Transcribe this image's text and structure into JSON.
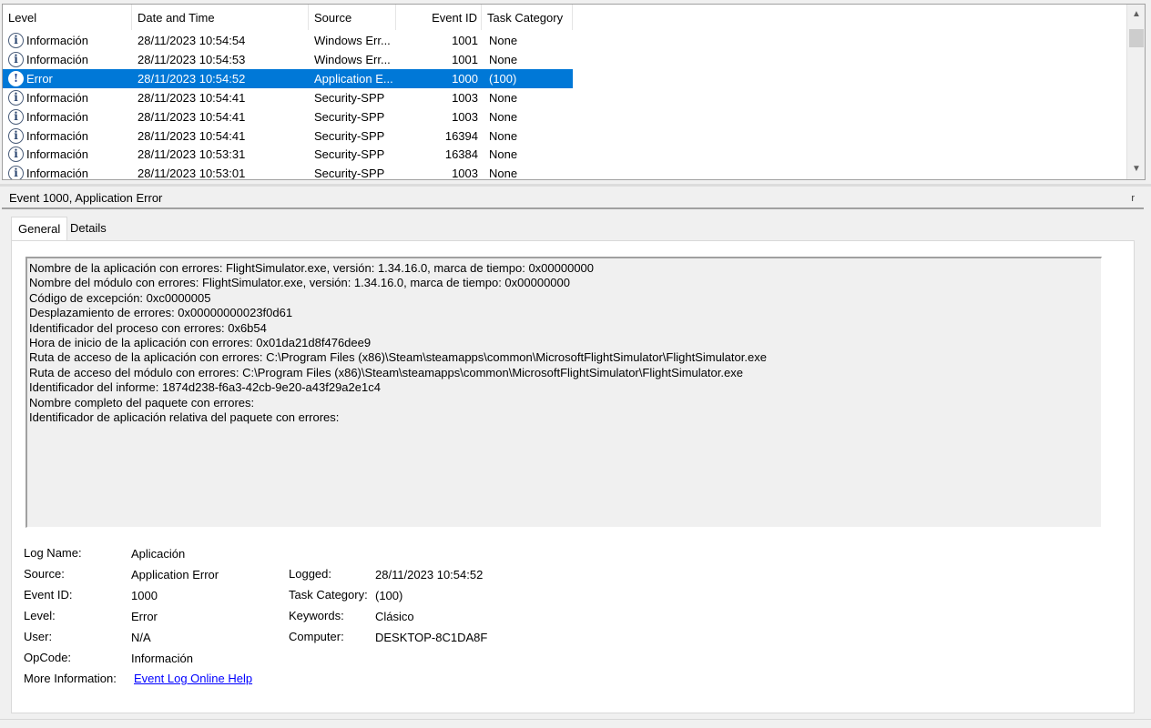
{
  "list": {
    "columns": [
      "Level",
      "Date and Time",
      "Source",
      "Event ID",
      "Task Category"
    ],
    "rows": [
      {
        "level": "Información",
        "date": "28/11/2023 10:54:54",
        "source": "Windows Err...",
        "event_id": "1001",
        "category": "None",
        "icon": "info-icon",
        "selected": false
      },
      {
        "level": "Información",
        "date": "28/11/2023 10:54:53",
        "source": "Windows Err...",
        "event_id": "1001",
        "category": "None",
        "icon": "info-icon",
        "selected": false
      },
      {
        "level": "Error",
        "date": "28/11/2023 10:54:52",
        "source": "Application E...",
        "event_id": "1000",
        "category": "(100)",
        "icon": "error-icon",
        "selected": true
      },
      {
        "level": "Información",
        "date": "28/11/2023 10:54:41",
        "source": "Security-SPP",
        "event_id": "1003",
        "category": "None",
        "icon": "info-icon",
        "selected": false
      },
      {
        "level": "Información",
        "date": "28/11/2023 10:54:41",
        "source": "Security-SPP",
        "event_id": "1003",
        "category": "None",
        "icon": "info-icon",
        "selected": false
      },
      {
        "level": "Información",
        "date": "28/11/2023 10:54:41",
        "source": "Security-SPP",
        "event_id": "16394",
        "category": "None",
        "icon": "info-icon",
        "selected": false
      },
      {
        "level": "Información",
        "date": "28/11/2023 10:53:31",
        "source": "Security-SPP",
        "event_id": "16384",
        "category": "None",
        "icon": "info-icon",
        "selected": false
      },
      {
        "level": "Información",
        "date": "28/11/2023 10:53:01",
        "source": "Security-SPP",
        "event_id": "1003",
        "category": "None",
        "icon": "info-icon",
        "selected": false
      }
    ]
  },
  "detail": {
    "title": "Event 1000, Application Error",
    "close_glyph": "r",
    "tabs": [
      "General",
      "Details"
    ],
    "description": [
      "Nombre de la aplicación con errores: FlightSimulator.exe, versión: 1.34.16.0, marca de tiempo: 0x00000000",
      "Nombre del módulo con errores: FlightSimulator.exe, versión: 1.34.16.0, marca de tiempo: 0x00000000",
      "Código de excepción: 0xc0000005",
      "Desplazamiento de errores: 0x00000000023f0d61",
      "Identificador del proceso con errores: 0x6b54",
      "Hora de inicio de la aplicación con errores: 0x01da21d8f476dee9",
      "Ruta de acceso de la aplicación con errores: C:\\Program Files (x86)\\Steam\\steamapps\\common\\MicrosoftFlightSimulator\\FlightSimulator.exe",
      "Ruta de acceso del módulo con errores: C:\\Program Files (x86)\\Steam\\steamapps\\common\\MicrosoftFlightSimulator\\FlightSimulator.exe",
      "Identificador del informe: 1874d238-f6a3-42cb-9e20-a43f29a2e1c4",
      "Nombre completo del paquete con errores:",
      "Identificador de aplicación relativa del paquete con errores:"
    ],
    "props": {
      "log_name_label": "Log Name:",
      "log_name": "Aplicación",
      "source_label": "Source:",
      "source": "Application Error",
      "logged_label": "Logged:",
      "logged": "28/11/2023 10:54:52",
      "event_id_label": "Event ID:",
      "event_id": "1000",
      "task_category_label": "Task Category:",
      "task_category": "(100)",
      "level_label": "Level:",
      "level": "Error",
      "keywords_label": "Keywords:",
      "keywords": "Clásico",
      "user_label": "User:",
      "user": "N/A",
      "computer_label": "Computer:",
      "computer": "DESKTOP-8C1DA8F",
      "opcode_label": "OpCode:",
      "opcode": "Información",
      "more_info_label": "More Information:",
      "more_info_link": "Event Log Online Help"
    }
  },
  "colors": {
    "selection": "#0078d7",
    "link": "#0000ff"
  }
}
